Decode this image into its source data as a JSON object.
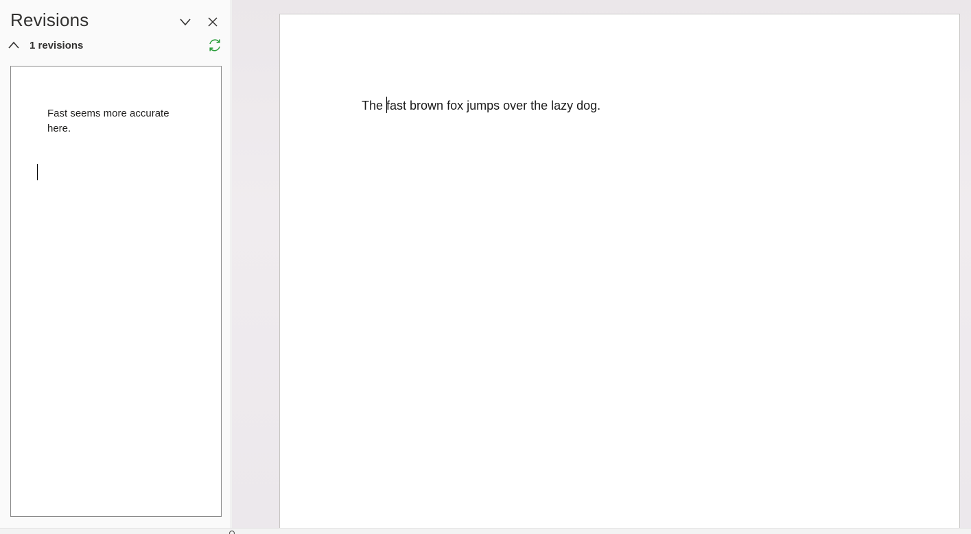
{
  "pane": {
    "title": "Revisions",
    "revision_count": "1 revisions",
    "icons": {
      "dropdown": "chevron-down-icon",
      "close": "close-icon",
      "collapse": "chevron-up-icon",
      "refresh": "refresh-icon"
    },
    "refresh_color": "#2a9d3a",
    "revisions": [
      {
        "comment": "Fast seems more accurate here."
      }
    ]
  },
  "document": {
    "before_caret": "The ",
    "after_caret": "fast brown fox jumps over the lazy dog."
  }
}
